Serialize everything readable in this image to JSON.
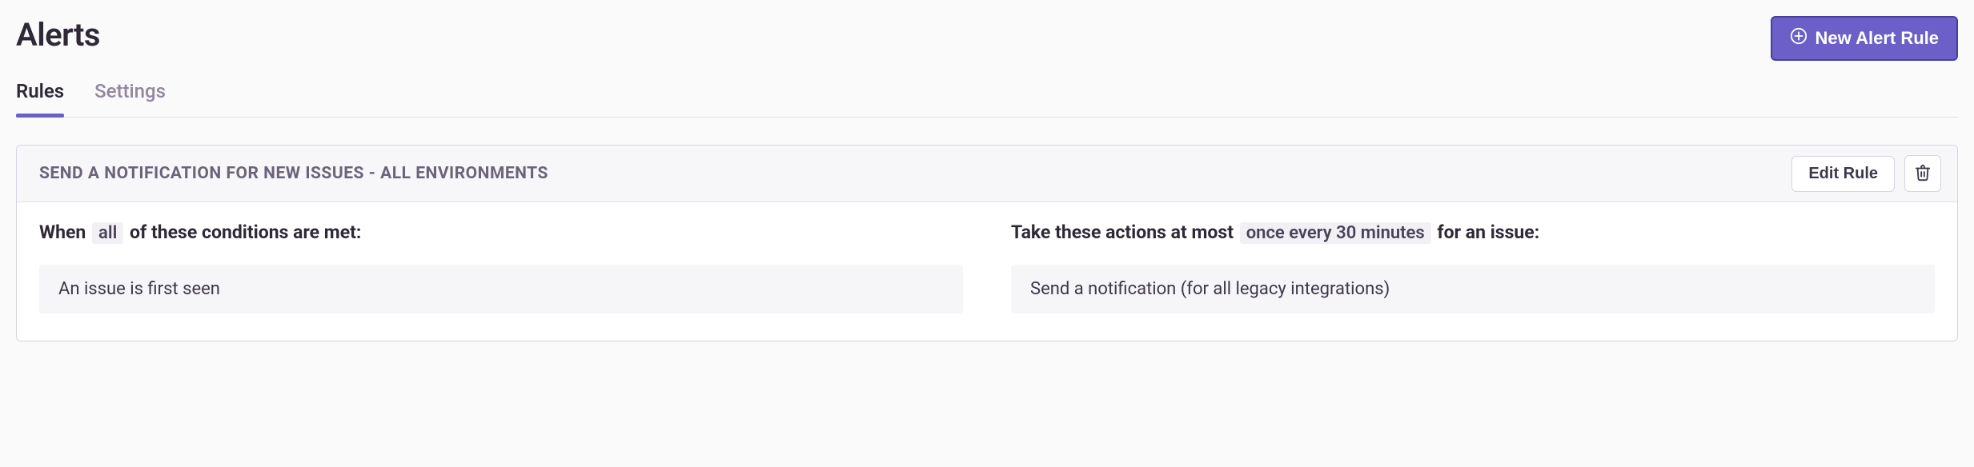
{
  "header": {
    "title": "Alerts",
    "new_button_label": "New Alert Rule"
  },
  "tabs": {
    "rules": "Rules",
    "settings": "Settings"
  },
  "rule": {
    "title": "SEND A NOTIFICATION FOR NEW ISSUES - ALL ENVIRONMENTS",
    "edit_label": "Edit Rule",
    "conditions": {
      "prefix": "When",
      "match": "all",
      "suffix": "of these conditions are met:",
      "items": [
        "An issue is first seen"
      ]
    },
    "actions": {
      "prefix": "Take these actions at most",
      "frequency": "once every 30 minutes",
      "suffix": "for an issue:",
      "items": [
        "Send a notification (for all legacy integrations)"
      ]
    }
  }
}
